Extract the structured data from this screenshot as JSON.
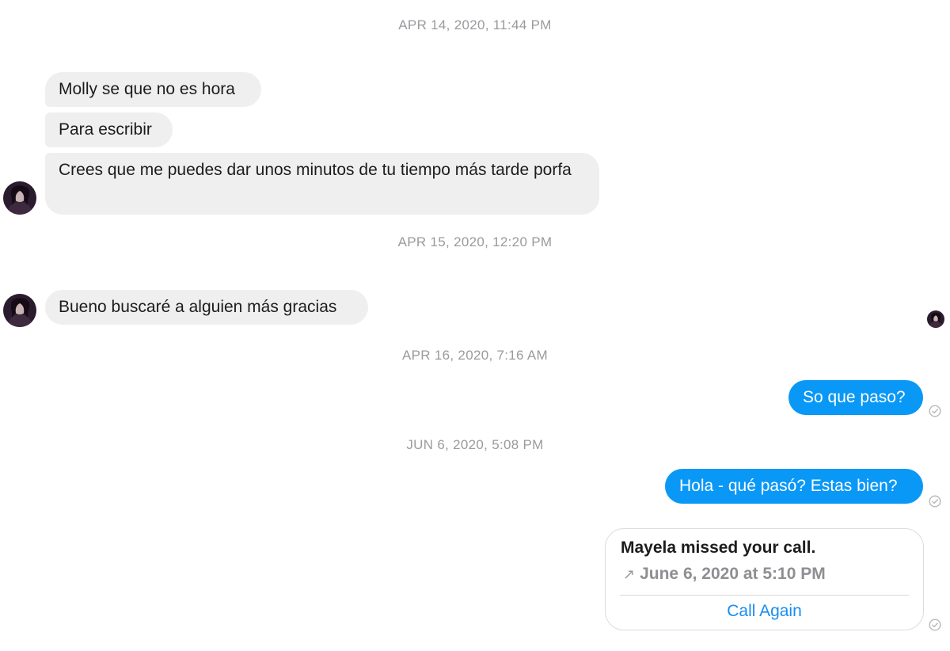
{
  "conversation": {
    "timestamps": [
      "APR 14, 2020, 11:44 PM",
      "APR 15, 2020, 12:20 PM",
      "APR 16, 2020, 7:16 AM",
      "JUN 6, 2020, 5:08 PM"
    ],
    "incoming": [
      "Molly se que no es hora",
      "Para escribir",
      "Crees que me puedes dar unos minutos de tu tiempo más tarde porfa",
      "Bueno buscaré a alguien más gracias"
    ],
    "outgoing": [
      "So que paso?",
      "Hola - qué pasó? Estas bien?"
    ],
    "call_card": {
      "title": "Mayela missed your call.",
      "arrow": "↗",
      "time": "June 6, 2020 at 5:10 PM",
      "action": "Call Again"
    }
  },
  "colors": {
    "incoming_bubble": "#efeff0",
    "outgoing_bubble": "#0a98f6",
    "link": "#1a8cf0",
    "timestamp": "#9a9a9f"
  },
  "icons": {
    "avatar": "contact-avatar",
    "read_receipt": "check-circle-icon"
  }
}
